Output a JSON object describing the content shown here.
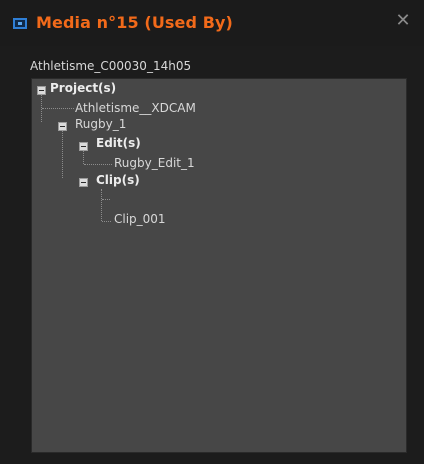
{
  "window": {
    "title": "Media n°15 (Used By)",
    "title_color": "#f26a1a",
    "icon": "media-window-icon",
    "close_icon": "close-icon"
  },
  "media": {
    "name": "Athletisme_C00030_14h05"
  },
  "tree": {
    "projects_label": "Project(s)",
    "projects": [
      {
        "label": "Athletisme__XDCAM"
      },
      {
        "label": "Rugby_1",
        "edits_label": "Edit(s)",
        "edits": [
          "Rugby_Edit_1"
        ],
        "clips_label": "Clip(s)",
        "clips": [
          "",
          "Clip_001"
        ]
      }
    ]
  }
}
